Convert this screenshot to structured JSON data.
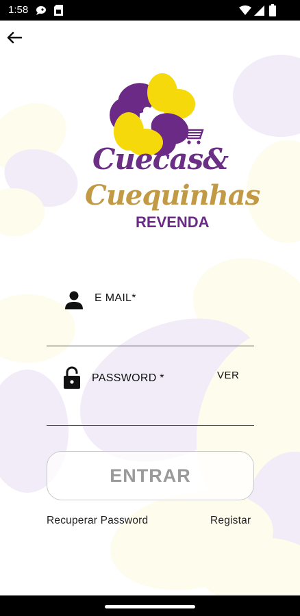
{
  "status_bar": {
    "time": "1:58",
    "icons": [
      "chat-bubble-icon",
      "sim-card-icon",
      "wifi-icon",
      "cellular-signal-icon",
      "battery-icon"
    ]
  },
  "nav": {
    "back_icon": "arrow-left-icon"
  },
  "logo": {
    "line1": "Cuecas&",
    "line2": "Cuequinhas",
    "subtitle": "REVENDA",
    "colors": {
      "purple": "#6a2a86",
      "yellow": "#f5d90a",
      "gold": "#c29a46"
    }
  },
  "form": {
    "email": {
      "label": "E MAIL*",
      "value": "",
      "icon": "person-icon"
    },
    "password": {
      "label": "PASSWORD *",
      "value": "",
      "icon": "lock-icon",
      "toggle_label": "VER"
    },
    "submit_label": "ENTRAR"
  },
  "links": {
    "recover_password": "Recuperar Password",
    "register": "Registar"
  }
}
